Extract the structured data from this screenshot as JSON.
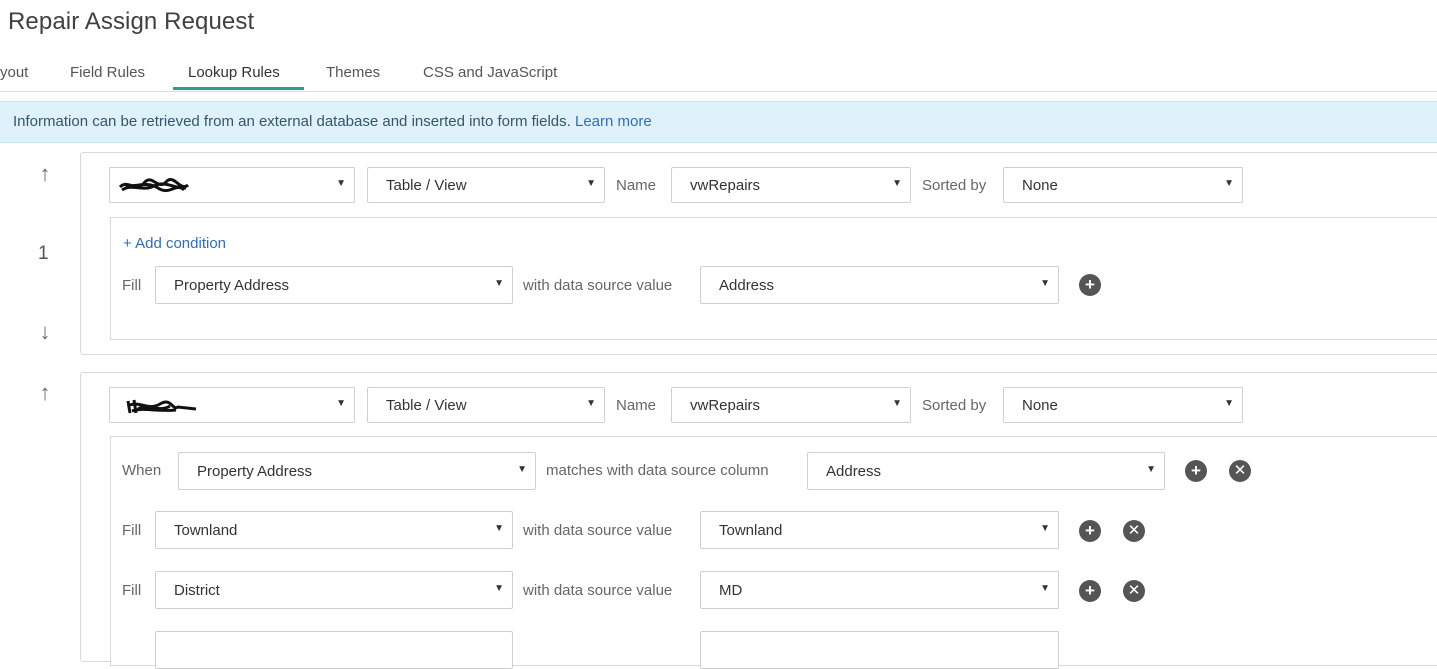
{
  "page_title": "Repair Assign Request",
  "tabs": [
    {
      "label": "yout"
    },
    {
      "label": "Field Rules"
    },
    {
      "label": "Lookup Rules"
    },
    {
      "label": "Themes"
    },
    {
      "label": "CSS and JavaScript"
    }
  ],
  "info": {
    "text": "Information can be retrieved from an external database and inserted into form fields.",
    "link": "Learn more"
  },
  "labels": {
    "name": "Name",
    "sorted_by": "Sorted by",
    "fill": "Fill",
    "when": "When",
    "with_value": "with data source value",
    "matches": "matches with data source column",
    "add_condition": "+ Add condition"
  },
  "rules": [
    {
      "number": "1",
      "source_type": "Table / View",
      "name": "vwRepairs",
      "sorted_by": "None",
      "fills": [
        {
          "field": "Property Address",
          "value": "Address"
        }
      ]
    },
    {
      "source_type": "Table / View",
      "name": "vwRepairs",
      "sorted_by": "None",
      "when": {
        "field": "Property Address",
        "column": "Address"
      },
      "fills": [
        {
          "field": "Townland",
          "value": "Townland"
        },
        {
          "field": "District",
          "value": "MD"
        }
      ]
    }
  ],
  "icons": {
    "up": "arrow-up-icon",
    "down": "arrow-down-icon",
    "add": "plus-circle-icon",
    "remove": "x-circle-icon",
    "caret": "caret-down-icon"
  },
  "colors": {
    "accent": "#2a9d8f",
    "info_bg": "#dff2fb",
    "link": "#2f6fb8"
  }
}
